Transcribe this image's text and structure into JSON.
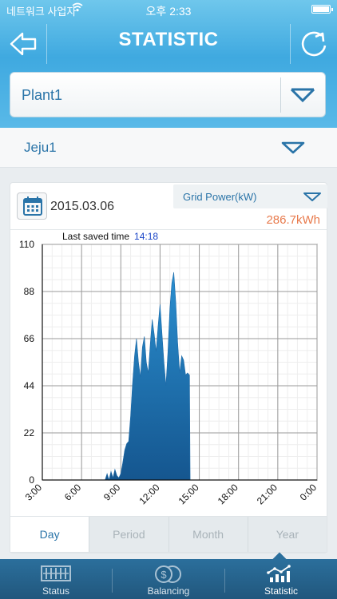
{
  "status_bar": {
    "carrier": "네트워크 사업자",
    "time": "오후 2:33"
  },
  "nav": {
    "title": "STATISTIC"
  },
  "plant": {
    "selected": "Plant1"
  },
  "site": {
    "selected": "Jeju1"
  },
  "card": {
    "date": "2015.03.06",
    "metric": "Grid Power(kW)",
    "total": "286.7kWh",
    "last_saved_label": "Last saved time",
    "last_saved_time": "14:18"
  },
  "tabs": [
    {
      "label": "Day",
      "active": true
    },
    {
      "label": "Period",
      "active": false
    },
    {
      "label": "Month",
      "active": false
    },
    {
      "label": "Year",
      "active": false
    }
  ],
  "bottom_nav": [
    {
      "label": "Status",
      "icon": "grid-panel-icon",
      "active": false
    },
    {
      "label": "Balancing",
      "icon": "coins-icon",
      "active": false
    },
    {
      "label": "Statistic",
      "icon": "chart-icon",
      "active": true
    }
  ],
  "colors": {
    "accent": "#2a74a8",
    "header": "#3fa9e0",
    "fill": "#1d6aa8",
    "total": "#e87a4c"
  },
  "chart_data": {
    "type": "area",
    "ylim": [
      0,
      110
    ],
    "yticks": [
      0,
      22,
      44,
      66,
      88,
      110
    ],
    "xlim": [
      3,
      24
    ],
    "xtick_labels": [
      "3:00",
      "6:00",
      "9:00",
      "12:00",
      "15:00",
      "18:00",
      "21:00",
      "0:00"
    ],
    "xticks": [
      3,
      6,
      9,
      12,
      15,
      18,
      21,
      24
    ],
    "grid": true,
    "series": [
      {
        "x": [
          7.8,
          7.95,
          8.1,
          8.25,
          8.4,
          8.55,
          8.7,
          8.85,
          9.0,
          9.15,
          9.3,
          9.45,
          9.6,
          9.75,
          9.9,
          10.05,
          10.2,
          10.35,
          10.5,
          10.65,
          10.8,
          10.95,
          11.1,
          11.25,
          11.4,
          11.55,
          11.7,
          11.85,
          12.0,
          12.15,
          12.3,
          12.45,
          12.6,
          12.75,
          12.9,
          13.05,
          13.2,
          13.35,
          13.5,
          13.65,
          13.8,
          13.95,
          14.1,
          14.25,
          14.3
        ],
        "y": [
          0,
          3,
          0,
          4,
          1,
          5,
          2,
          1,
          3,
          8,
          14,
          17,
          18,
          30,
          45,
          58,
          66,
          55,
          48,
          62,
          67,
          55,
          50,
          63,
          75,
          68,
          60,
          72,
          82,
          68,
          55,
          44,
          60,
          80,
          92,
          97,
          83,
          64,
          50,
          58,
          56,
          49,
          50,
          49,
          0
        ]
      }
    ]
  }
}
